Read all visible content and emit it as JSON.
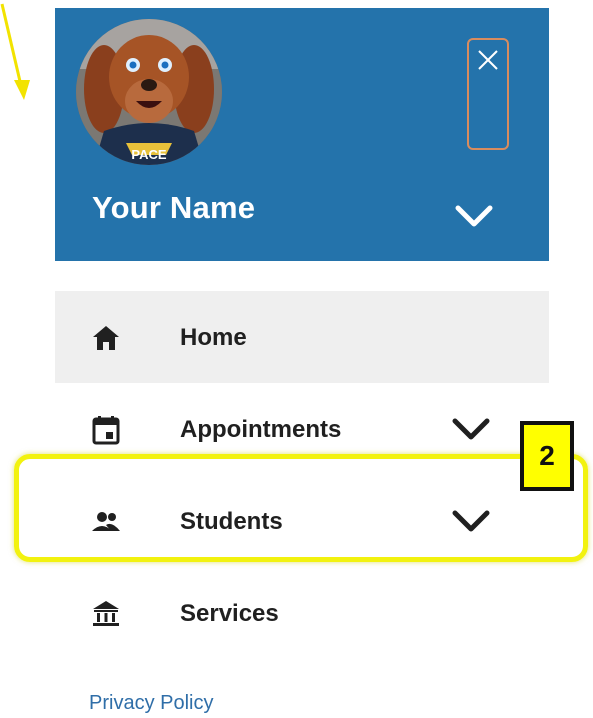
{
  "header": {
    "user_name": "Your Name",
    "avatar_icon": "mascot-avatar",
    "background_color": "#2473ab",
    "close_icon": "close-icon",
    "expand_icon": "chevron-down-icon"
  },
  "menu": {
    "items": [
      {
        "label": "Home",
        "icon": "home-icon",
        "active": true,
        "expandable": false
      },
      {
        "label": "Appointments",
        "icon": "calendar-icon",
        "active": false,
        "expandable": true
      },
      {
        "label": "Students",
        "icon": "people-icon",
        "active": false,
        "expandable": true
      },
      {
        "label": "Services",
        "icon": "bank-icon",
        "active": false,
        "expandable": false
      }
    ]
  },
  "footer": {
    "privacy_link": "Privacy Policy",
    "link_color": "#2f6ea8"
  },
  "annotations": {
    "step_badge": "2",
    "highlight_color": "#f2f20f"
  }
}
